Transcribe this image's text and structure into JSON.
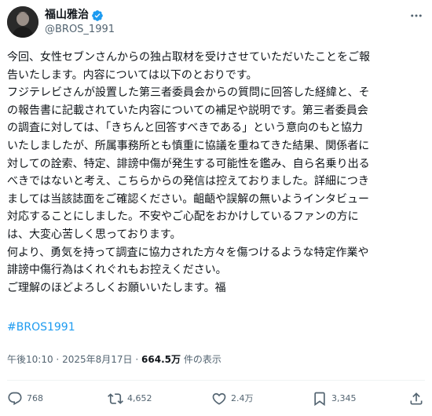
{
  "author": {
    "display_name": "福山雅治",
    "handle": "@BROS_1991"
  },
  "post": {
    "lines": [
      "今回、女性セブンさんからの独占取材を受けさせていただいたことをご報",
      "告いたします。内容については以下のとおりです。",
      "フジテレビさんが設置した第三者委員会からの質問に回答した経緯と、そ",
      "の報告書に記載されていた内容についての補足や説明です。第三者委員会",
      "の調査に対しては、「きちんと回答すべきである」という意向のもと協力",
      "いたしましたが、所属事務所とも慎重に協議を重ねてきた結果、関係者に",
      "対しての詮索、特定、誹謗中傷が発生する可能性を鑑み、自ら名乗り出る",
      "べきではないと考え、こちらからの発信は控えておりました。詳細につき",
      "ましては当該誌面をご確認ください。齟齬や誤解の無いようインタビュー",
      "対応することにしました。不安やご心配をおかけしているファンの方に",
      "は、大変心苦しく思っております。",
      "何より、勇気を持って調査に協力された方々を傷つけるような特定作業や",
      "誹謗中傷行為はくれぐれもお控えください。",
      "ご理解のほどよろしくお願いいたします。福"
    ],
    "hashtag": "#BROS1991"
  },
  "meta": {
    "time": "午後10:10",
    "separator": "·",
    "date": "2025年8月17日",
    "views_count": "664.5万",
    "views_label": "件の表示"
  },
  "actions": {
    "reply_count": "768",
    "repost_count": "4,652",
    "like_count": "2.4万",
    "bookmark_count": "3,345"
  },
  "icons": {
    "verified": "verified-badge-icon",
    "more": "more-options-icon",
    "reply": "reply-icon",
    "repost": "repost-icon",
    "like": "heart-icon",
    "bookmark": "bookmark-icon",
    "share": "share-icon"
  },
  "colors": {
    "verified": "#1d9bf0",
    "hashtag": "#1d9bf0",
    "secondary_text": "#536471",
    "primary_text": "#0f1419"
  }
}
